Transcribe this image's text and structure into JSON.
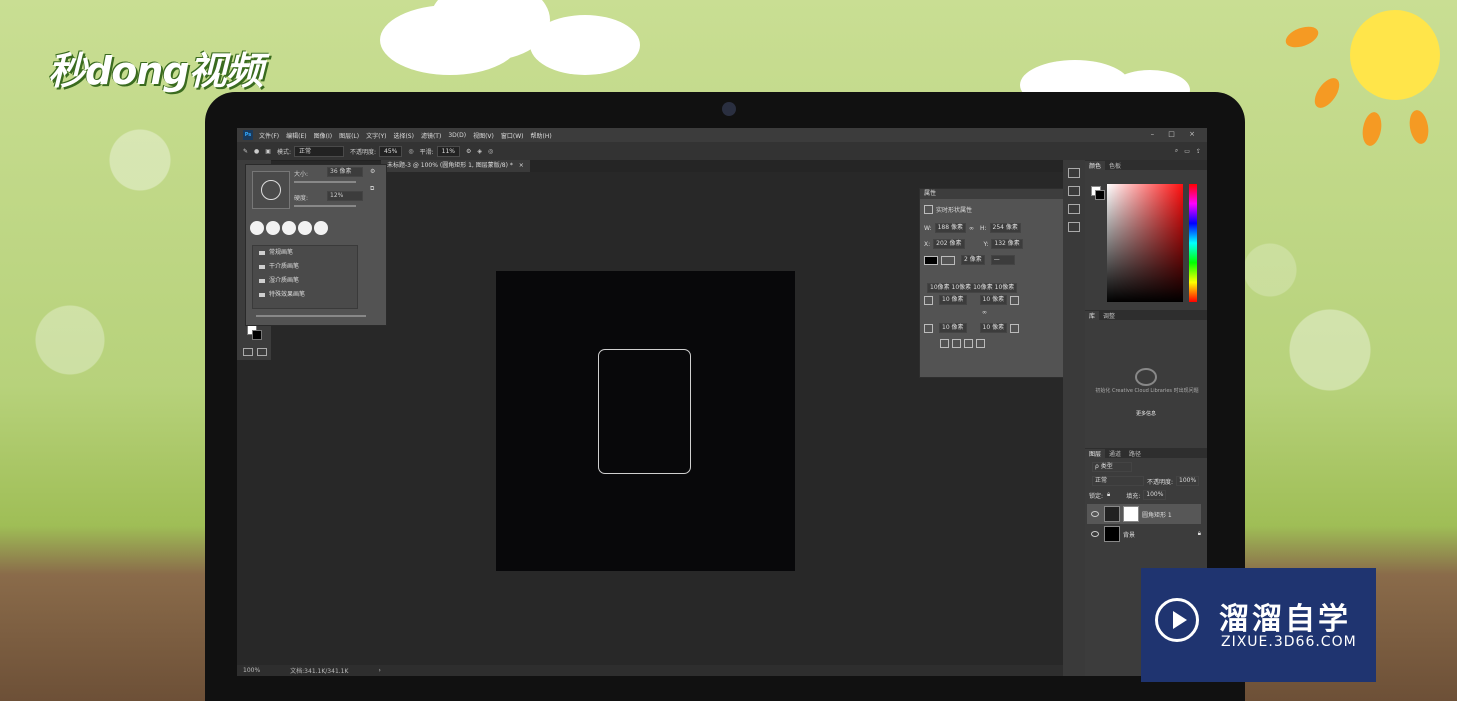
{
  "overlay": {
    "logo_text": "秒dong视频",
    "watermark_title": "溜溜自学",
    "watermark_url": "ZIXUE.3D66.COM"
  },
  "menubar": {
    "app_icon": "Ps",
    "items": [
      "文件(F)",
      "编辑(E)",
      "图像(I)",
      "图层(L)",
      "文字(Y)",
      "选择(S)",
      "滤镜(T)",
      "3D(D)",
      "视图(V)",
      "窗口(W)",
      "帮助(H)"
    ],
    "window_controls": "– □ ×"
  },
  "options_bar": {
    "mode_label": "模式:",
    "mode_value": "正常",
    "opacity_label": "不透明度:",
    "opacity_value": "45%",
    "flow_label": "平滑:",
    "flow_value": "11%"
  },
  "document_tab": {
    "title": "未标题-3 @ 100% (圆角矩形 1, 图层蒙版/8) *",
    "close": "×"
  },
  "brush_panel": {
    "size_label": "大小:",
    "size_value": "36 像素",
    "hardness_label": "硬度:",
    "hardness_value": "12%",
    "folders": [
      "常规画笔",
      "干介质画笔",
      "湿介质画笔",
      "特殊效果画笔"
    ]
  },
  "properties_panel": {
    "tab": "属性",
    "subtitle": "实时形状属性",
    "w_label": "W:",
    "w_value": "188 像素",
    "h_label": "H:",
    "h_value": "254 像素",
    "x_label": "X:",
    "x_value": "202 像素",
    "y_label": "Y:",
    "y_value": "132 像素",
    "stroke_value": "2 像素",
    "corners_all": "10像素 10像素 10像素 10像素",
    "corner_tl": "10 像素",
    "corner_tr": "10 像素",
    "corner_bl": "10 像素",
    "corner_br": "10 像素"
  },
  "color_panel": {
    "tabs": [
      "颜色",
      "色板"
    ],
    "accent": "#ff1010"
  },
  "libraries_panel": {
    "tabs": [
      "库",
      "调整"
    ],
    "message": "初始化 Creative Cloud Libraries 时出现问题",
    "link": "更多信息"
  },
  "layers_panel": {
    "tabs": [
      "图层",
      "通道",
      "路径"
    ],
    "filter_label": "ρ 类型",
    "blend_mode": "正常",
    "opacity_label": "不透明度:",
    "opacity_value": "100%",
    "lock_label": "锁定:",
    "fill_label": "填充:",
    "fill_value": "100%",
    "layers": [
      {
        "name": "圆角矩形 1",
        "selected": true
      },
      {
        "name": "背景",
        "selected": false
      }
    ]
  },
  "status_bar": {
    "zoom": "100%",
    "doc_info": "文档:341.1K/341.1K",
    "arrow": "›"
  }
}
